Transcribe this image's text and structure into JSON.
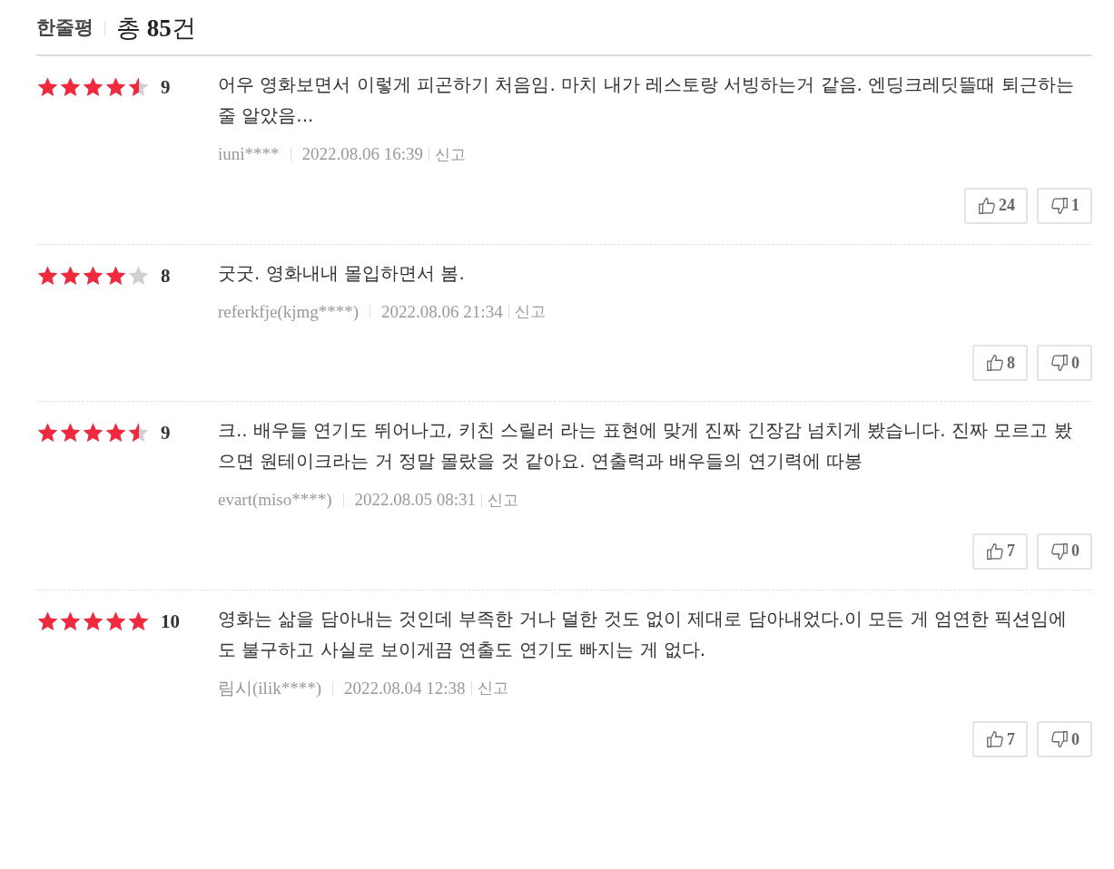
{
  "header": {
    "title": "한줄평",
    "total_prefix": "총",
    "total_count": "85",
    "total_suffix": "건"
  },
  "reviews": [
    {
      "stars": 4.5,
      "score": "9",
      "text": "어우 영화보면서 이렇게 피곤하기 처음임. 마치 내가 레스토랑 서빙하는거 같음. 엔딩크레딧뜰때 퇴근하는줄 알았음...",
      "author": "iuni****",
      "date": "2022.08.06 16:39",
      "report": "신고",
      "likes": "24",
      "dislikes": "1"
    },
    {
      "stars": 4,
      "score": "8",
      "text": "굿굿. 영화내내 몰입하면서 봄.",
      "author": "referkfje(kjmg****)",
      "date": "2022.08.06 21:34",
      "report": "신고",
      "likes": "8",
      "dislikes": "0"
    },
    {
      "stars": 4.5,
      "score": "9",
      "text": "크.. 배우들 연기도 뛰어나고, 키친 스릴러 라는 표현에 맞게 진짜 긴장감 넘치게 봤습니다. 진짜 모르고 봤으면 원테이크라는 거 정말 몰랐을 것 같아요. 연출력과 배우들의 연기력에 따봉",
      "author": "evart(miso****)",
      "date": "2022.08.05 08:31",
      "report": "신고",
      "likes": "7",
      "dislikes": "0"
    },
    {
      "stars": 5,
      "score": "10",
      "text": "영화는 삶을 담아내는 것인데 부족한 거나 덜한 것도 없이 제대로 담아내었다.이 모든 게 엄연한 픽션임에도 불구하고 사실로 보이게끔 연출도 연기도 빠지는 게 없다.",
      "author": "림시(ilik****)",
      "date": "2022.08.04 12:38",
      "report": "신고",
      "likes": "7",
      "dislikes": "0"
    }
  ]
}
